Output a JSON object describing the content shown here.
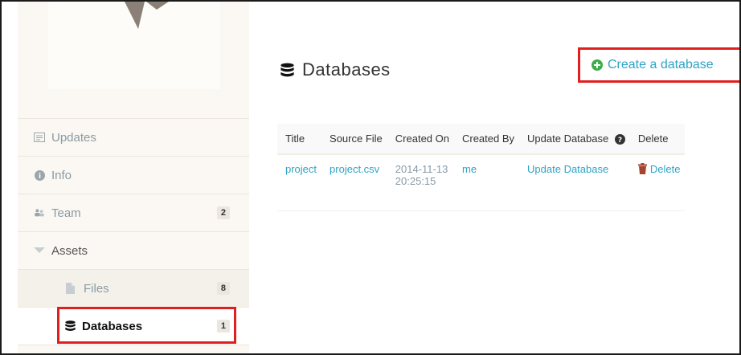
{
  "sidebar": {
    "items": [
      {
        "label": "Updates",
        "icon": "updates-icon"
      },
      {
        "label": "Info",
        "icon": "info-icon"
      },
      {
        "label": "Team",
        "icon": "team-icon",
        "badge": "2"
      },
      {
        "label": "Assets",
        "icon": "triangle-down-icon"
      },
      {
        "label": "Files",
        "icon": "file-icon",
        "badge": "8"
      },
      {
        "label": "Databases",
        "icon": "database-icon",
        "badge": "1",
        "active": true
      }
    ]
  },
  "main": {
    "title": "Databases",
    "create_label": "Create a database",
    "table": {
      "headers": [
        "Title",
        "Source File",
        "Created On",
        "Created By",
        "Update Database",
        "Delete"
      ],
      "rows": [
        {
          "title": "project",
          "source_file": "project.csv",
          "created_date": "2014-11-13",
          "created_time": "20:25:15",
          "created_by": "me",
          "update": "Update Database",
          "delete": "Delete"
        }
      ]
    }
  },
  "colors": {
    "link": "#2ea3c5",
    "highlight": "#e0201e",
    "create_icon": "#3bae49"
  }
}
